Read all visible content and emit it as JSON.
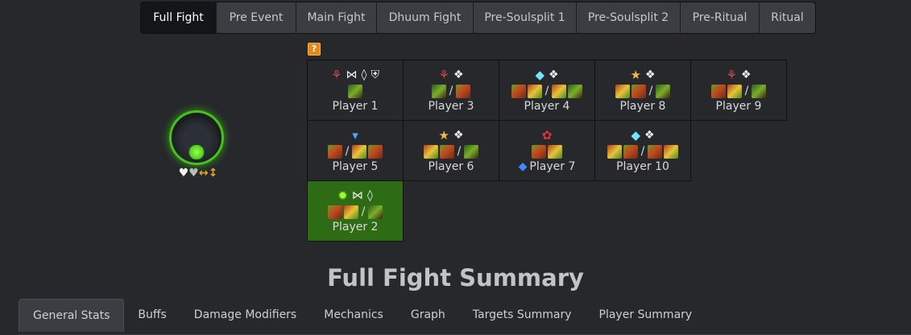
{
  "phase_tabs": [
    {
      "label": "Full Fight",
      "active": true
    },
    {
      "label": "Pre Event",
      "active": false
    },
    {
      "label": "Main Fight",
      "active": false
    },
    {
      "label": "Dhuum Fight",
      "active": false
    },
    {
      "label": "Pre-Soulsplit 1",
      "active": false
    },
    {
      "label": "Pre-Soulsplit 2",
      "active": false
    },
    {
      "label": "Pre-Ritual",
      "active": false
    },
    {
      "label": "Ritual",
      "active": false
    }
  ],
  "help_badge": "?",
  "target": {
    "portrait_icon": "dhuum-portrait-icon",
    "status_icons": [
      "heart-icon",
      "heart-icon",
      "double-arrow-icon",
      "up-arrow-icon"
    ]
  },
  "squad": {
    "rows": [
      [
        {
          "name": "Player 1",
          "spec_icon": "reaper-icon",
          "roles": [
            "condition-icon",
            "boon-icon",
            "healing-icon"
          ],
          "weapons": [
            "b"
          ],
          "highlight": false
        },
        {
          "name": "Player 3",
          "spec_icon": "reaper-icon",
          "roles": [
            "dps-icon"
          ],
          "weapons": [
            "b",
            "/",
            "a"
          ],
          "highlight": false
        },
        {
          "name": "Player 4",
          "spec_icon": "tempest-icon",
          "roles": [
            "dps-icon"
          ],
          "weapons": [
            "a",
            "/",
            "c"
          ],
          "highlight": false
        },
        {
          "name": "Player 8",
          "spec_icon": "firebrand-icon",
          "roles": [
            "dps-icon"
          ],
          "weapons": [
            "c",
            "/",
            "b"
          ],
          "highlight": false
        },
        {
          "name": "Player 9",
          "spec_icon": "reaper-icon",
          "roles": [
            "dps-icon"
          ],
          "weapons": [
            "a",
            "/",
            "b"
          ],
          "highlight": false
        }
      ],
      [
        {
          "name": "Player 5",
          "spec_icon": "chronomancer-icon",
          "roles": [],
          "weapons": [
            "a",
            "/",
            "c"
          ],
          "highlight": false
        },
        {
          "name": "Player 6",
          "spec_icon": "firebrand-icon",
          "roles": [
            "dps-icon"
          ],
          "weapons": [
            "c",
            "/",
            "b"
          ],
          "highlight": false
        },
        {
          "name": "Player 7",
          "spec_icon": "renegade-icon",
          "roles": [],
          "weapons": [
            "a"
          ],
          "commander": true,
          "highlight": false
        },
        {
          "name": "Player 10",
          "spec_icon": "tempest-icon",
          "roles": [
            "dps-icon"
          ],
          "weapons": [
            "c",
            "/",
            "a"
          ],
          "highlight": false
        }
      ],
      [
        {
          "name": "Player 2",
          "spec_icon": "druid-icon",
          "roles": [
            "condition-icon",
            "healing-icon"
          ],
          "weapons": [
            "a",
            "/",
            "b"
          ],
          "highlight": true
        }
      ]
    ]
  },
  "summary_title": "Full Fight Summary",
  "bottom_tabs": [
    {
      "label": "General Stats",
      "active": true
    },
    {
      "label": "Buffs",
      "active": false
    },
    {
      "label": "Damage Modifiers",
      "active": false
    },
    {
      "label": "Mechanics",
      "active": false
    },
    {
      "label": "Graph",
      "active": false
    },
    {
      "label": "Targets Summary",
      "active": false
    },
    {
      "label": "Player Summary",
      "active": false
    }
  ]
}
